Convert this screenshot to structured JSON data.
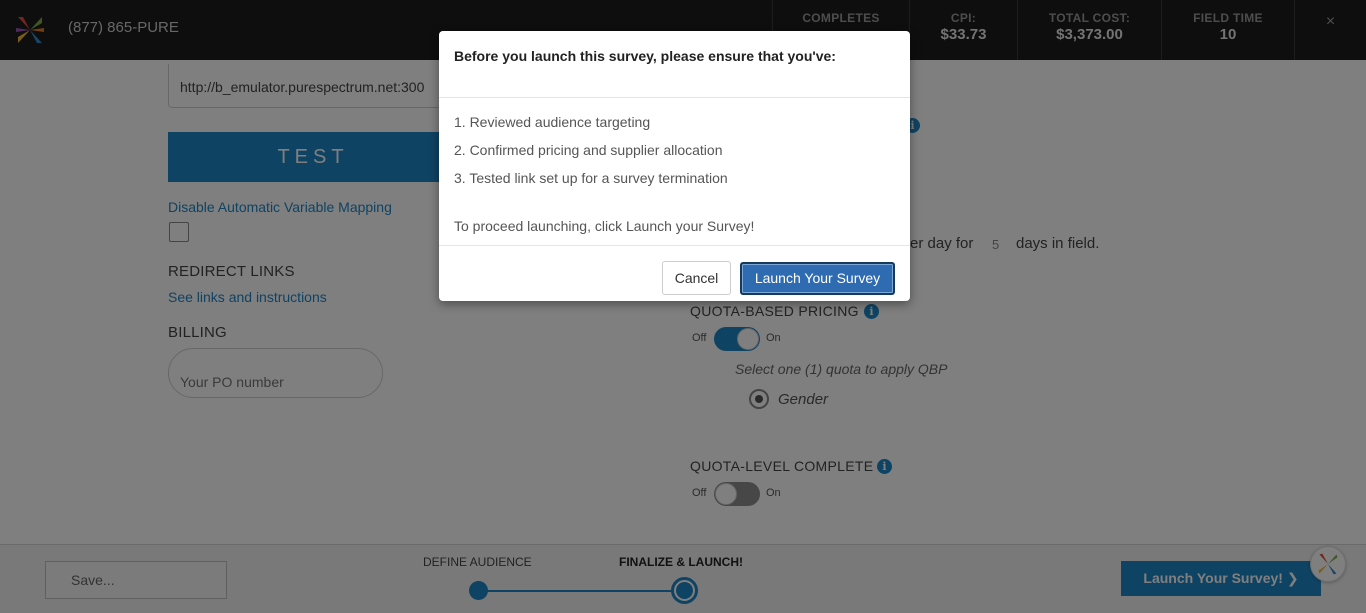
{
  "header": {
    "phone": "(877) 865-PURE",
    "stats": [
      {
        "label": "COMPLETES",
        "value": ""
      },
      {
        "label": "CPI:",
        "value": "$33.73"
      },
      {
        "label": "TOTAL COST:",
        "value": "$3,373.00"
      },
      {
        "label": "FIELD TIME",
        "value": "10"
      }
    ],
    "close_glyph": "×"
  },
  "main": {
    "url_value": "http://b_emulator.purespectrum.net:300",
    "test_label": "TEST",
    "disable_link": "Disable Automatic Variable Mapping",
    "redirect_heading": "REDIRECT LINKS",
    "redirect_link": "See links and instructions",
    "billing_heading": "BILLING",
    "po_placeholder": "Your PO number"
  },
  "right": {
    "info_glyph": "i",
    "per_day_prefix": "er day for",
    "days_value": "5",
    "days_suffix": "days in field.",
    "qbp_heading": "QUOTA-BASED PRICING",
    "qbp_toggle": {
      "off": "Off",
      "on": "On",
      "state": "on"
    },
    "qbp_note": "Select one (1) quota to apply QBP",
    "gender_label": "Gender",
    "qlc_heading": "QUOTA-LEVEL COMPLETE",
    "qlc_toggle": {
      "off": "Off",
      "on": "On",
      "state": "off"
    }
  },
  "footer": {
    "save_label": "Save...",
    "steps": [
      {
        "label": "DEFINE AUDIENCE"
      },
      {
        "label": "FINALIZE & LAUNCH!"
      }
    ],
    "launch_label": "Launch Your Survey! ❯"
  },
  "modal": {
    "title": "Before you launch this survey, please ensure that you've:",
    "items": [
      "1. Reviewed audience targeting",
      "2. Confirmed pricing and supplier allocation",
      "3. Tested link set up for a survey termination"
    ],
    "proceed_text": "To proceed launching, click Launch your Survey!",
    "cancel_label": "Cancel",
    "launch_label": "Launch Your Survey"
  },
  "colors": {
    "accent": "#1f86c7",
    "header_bg": "#1c1c1c",
    "modal_primary": "#2e6bb0"
  }
}
